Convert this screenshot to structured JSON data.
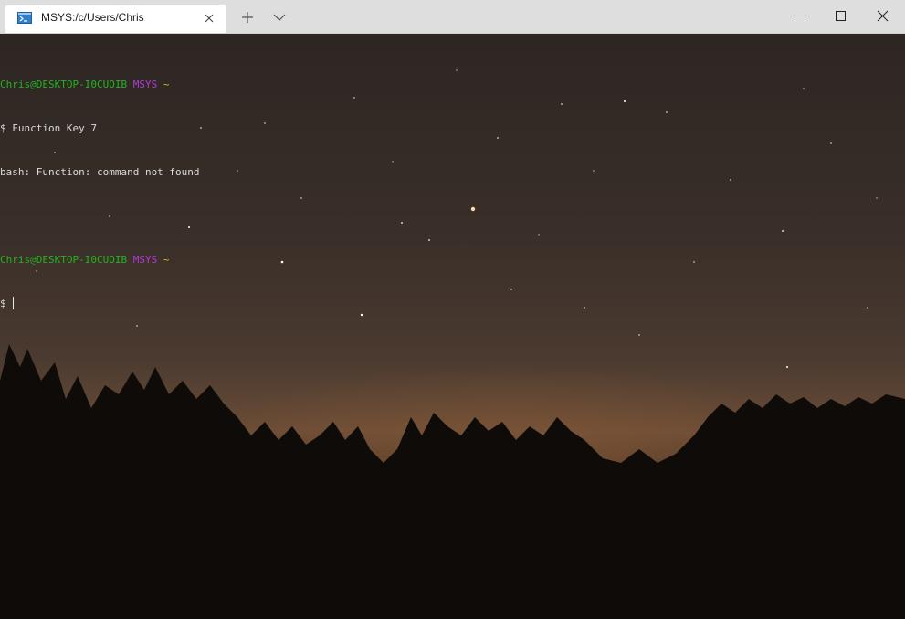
{
  "tab": {
    "title": "MSYS:/c/Users/Chris",
    "icon": "terminal-icon"
  },
  "titlebar": {
    "new_tab_icon": "plus-icon",
    "dropdown_icon": "chevron-down-icon",
    "minimize_icon": "minimize-icon",
    "maximize_icon": "maximize-icon",
    "close_icon": "close-icon"
  },
  "terminal": {
    "background": "night-sky-treeline",
    "colors": {
      "user_host": "#23b123",
      "msystem": "#b03bd6",
      "cwd": "#c7c024",
      "text": "#d8d8d8"
    },
    "lines": [
      {
        "user_host": "Chris@DESKTOP-I0CUOIB",
        "msystem": "MSYS",
        "cwd": "~"
      },
      {
        "prompt": "$",
        "command": "Function Key 7"
      },
      {
        "output": "bash: Function: command not found"
      },
      {
        "blank": ""
      },
      {
        "user_host": "Chris@DESKTOP-I0CUOIB",
        "msystem": "MSYS",
        "cwd": "~"
      },
      {
        "prompt": "$",
        "command": ""
      }
    ]
  }
}
